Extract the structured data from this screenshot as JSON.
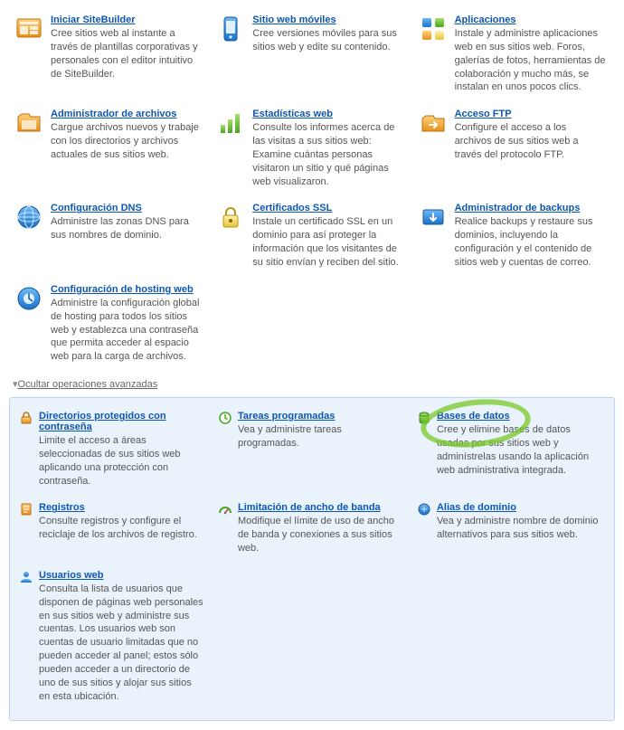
{
  "main": [
    {
      "id": "sitebuilder",
      "icon": "sitebuilder",
      "title": "Iniciar SiteBuilder",
      "desc": "Cree sitios web al instante a través de plantillas corporativas y personales con el editor intuitivo de SiteBuilder."
    },
    {
      "id": "mobile",
      "icon": "mobile",
      "title": "Sitio web móviles",
      "desc": "Cree versiones móviles para sus sitios web y edite su contenido."
    },
    {
      "id": "apps",
      "icon": "apps",
      "title": "Aplicaciones",
      "desc": "Instale y administre aplicaciones web en sus sitios web. Foros, galerías de fotos, herramientas de colaboración y mucho más, se instalan en unos pocos clics."
    },
    {
      "id": "files",
      "icon": "files",
      "title": "Administrador de archivos",
      "desc": "Cargue archivos nuevos y trabaje con los directorios y archivos actuales de sus sitios web."
    },
    {
      "id": "stats",
      "icon": "stats",
      "title": "Estadísticas web",
      "desc": "Consulte los informes acerca de las visitas a sus sitios web: Examine cuántas personas visitaron un sitio y qué páginas web visualizaron."
    },
    {
      "id": "ftp",
      "icon": "ftp",
      "title": "Acceso FTP",
      "desc": "Configure el acceso a los archivos de sus sitios web a través del protocolo FTP."
    },
    {
      "id": "dns",
      "icon": "dns",
      "title": "Configuración DNS",
      "desc": "Administre las zonas DNS para sus nombres de dominio."
    },
    {
      "id": "ssl",
      "icon": "ssl",
      "title": "Certificados SSL",
      "desc": "Instale un certificado SSL en un dominio para así proteger la información que los visitantes de su sitio envían y reciben del sitio."
    },
    {
      "id": "backup",
      "icon": "backup",
      "title": "Administrador de backups",
      "desc": "Realice backups y restaure sus dominios, incluyendo la configuración y el contenido de sitios web y cuentas de correo."
    },
    {
      "id": "hosting",
      "icon": "hosting",
      "title": "Configuración de hosting web",
      "desc": "Administre la configuración global de hosting para todos los sitios web y establezca una contraseña que permita acceder al espacio web para la carga de archivos."
    }
  ],
  "toggle_label": "Ocultar operaciones avanzadas",
  "advanced": [
    {
      "id": "protdirs",
      "icon": "lock",
      "title": "Directorios protegidos con contraseña",
      "desc": "Limite el acceso a áreas seleccionadas de sus sitios web aplicando una protección con contraseña."
    },
    {
      "id": "tasks",
      "icon": "clock",
      "title": "Tareas programadas",
      "desc": "Vea y administre tareas programadas."
    },
    {
      "id": "db",
      "icon": "db",
      "title": "Bases de datos",
      "desc": "Cree y elimine bases de datos usadas por sus sitios web y adminístrelas usando la aplicación web administrativa integrada.",
      "highlight": true
    },
    {
      "id": "logs",
      "icon": "logs",
      "title": "Registros",
      "desc": "Consulte registros y configure el reciclaje de los archivos de registro."
    },
    {
      "id": "bandwidth",
      "icon": "gauge",
      "title": "Limitación de ancho de banda",
      "desc": "Modifique el límite de uso de ancho de banda y conexiones a sus sitios web."
    },
    {
      "id": "alias",
      "icon": "alias",
      "title": "Alias de dominio",
      "desc": "Vea y administre nombre de dominio alternativos para sus sitios web."
    },
    {
      "id": "webusers",
      "icon": "users",
      "title": "Usuarios web",
      "desc": "Consulta la lista de usuarios que disponen de páginas web personales en sus sitios web y administre sus cuentas. Los usuarios web son cuentas de usuario limitadas que no pueden acceder al panel; estos sólo pueden acceder a un directorio de uno de sus sitios y alojar sus sitios en esta ubicación."
    }
  ]
}
